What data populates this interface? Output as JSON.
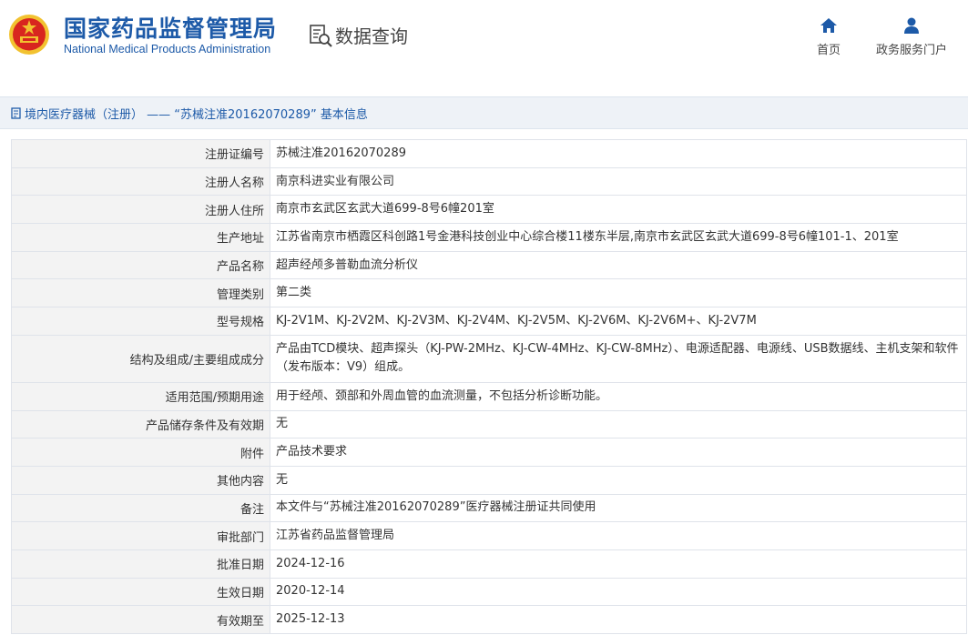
{
  "header": {
    "brand_cn": "国家药品监督管理局",
    "brand_en": "National Medical Products Administration",
    "query_label": "数据查询",
    "nav": [
      {
        "label": "首页",
        "icon": "home-icon"
      },
      {
        "label": "政务服务门户",
        "icon": "user-icon"
      }
    ],
    "colors": {
      "brand": "#1d5aa8",
      "emblem_red": "#d8261f",
      "emblem_gold": "#f2c230"
    }
  },
  "breadcrumb": {
    "text": "境内医疗器械（注册） —— “苏械注准20162070289” 基本信息"
  },
  "rows": [
    {
      "label": "注册证编号",
      "value": "苏械注准20162070289"
    },
    {
      "label": "注册人名称",
      "value": "南京科进实业有限公司"
    },
    {
      "label": "注册人住所",
      "value": "南京市玄武区玄武大道699-8号6幢201室"
    },
    {
      "label": "生产地址",
      "value": "江苏省南京市栖霞区科创路1号金港科技创业中心综合楼11楼东半层,南京市玄武区玄武大道699-8号6幢101-1、201室"
    },
    {
      "label": "产品名称",
      "value": "超声经颅多普勒血流分析仪"
    },
    {
      "label": "管理类别",
      "value": "第二类"
    },
    {
      "label": "型号规格",
      "value": "KJ-2V1M、KJ-2V2M、KJ-2V3M、KJ-2V4M、KJ-2V5M、KJ-2V6M、KJ-2V6M+、KJ-2V7M"
    },
    {
      "label": "结构及组成/主要组成成分",
      "value": "产品由TCD模块、超声探头（KJ-PW-2MHz、KJ-CW-4MHz、KJ-CW-8MHz）、电源适配器、电源线、USB数据线、主机支架和软件（发布版本：V9）组成。"
    },
    {
      "label": "适用范围/预期用途",
      "value": "用于经颅、颈部和外周血管的血流测量，不包括分析诊断功能。"
    },
    {
      "label": "产品储存条件及有效期",
      "value": "无"
    },
    {
      "label": "附件",
      "value": "产品技术要求"
    },
    {
      "label": "其他内容",
      "value": "无"
    },
    {
      "label": "备注",
      "value": "本文件与“苏械注准20162070289”医疗器械注册证共同使用"
    },
    {
      "label": "审批部门",
      "value": "江苏省药品监督管理局"
    },
    {
      "label": "批准日期",
      "value": "2024-12-16"
    },
    {
      "label": "生效日期",
      "value": "2020-12-14"
    },
    {
      "label": "有效期至",
      "value": "2025-12-13"
    }
  ]
}
